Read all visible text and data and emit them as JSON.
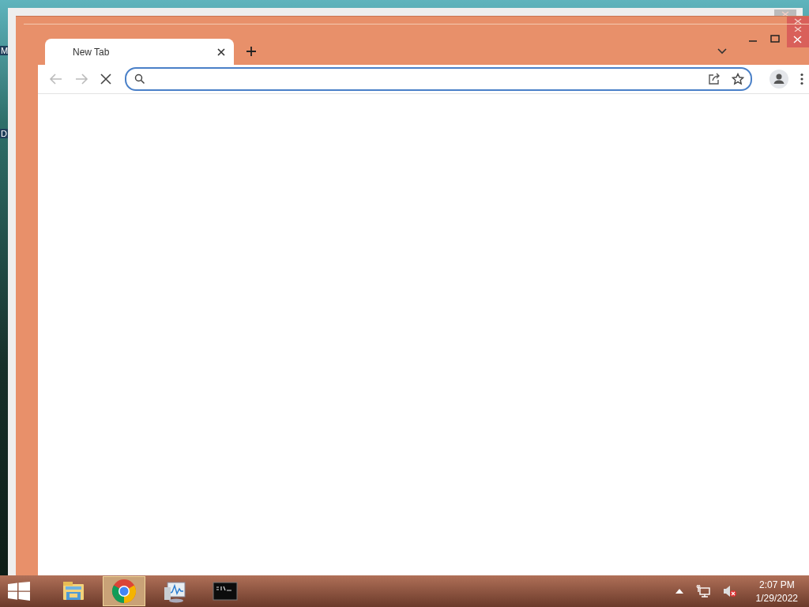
{
  "desktop_labels": [
    "M",
    "D"
  ],
  "browser": {
    "tabs": [
      {
        "title": "New Tab",
        "selected": true
      }
    ],
    "loading": true,
    "address": {
      "focused": true
    }
  },
  "taskbar": {
    "apps": [
      {
        "kind": "explorer",
        "selected": false
      },
      {
        "kind": "chrome",
        "selected": true
      },
      {
        "kind": "monitor",
        "selected": false
      },
      {
        "kind": "console",
        "selected": false
      }
    ]
  },
  "tray": {
    "volume_muted": true
  },
  "clock": {
    "time": "2:07 PM",
    "date": "1/29/2022"
  }
}
